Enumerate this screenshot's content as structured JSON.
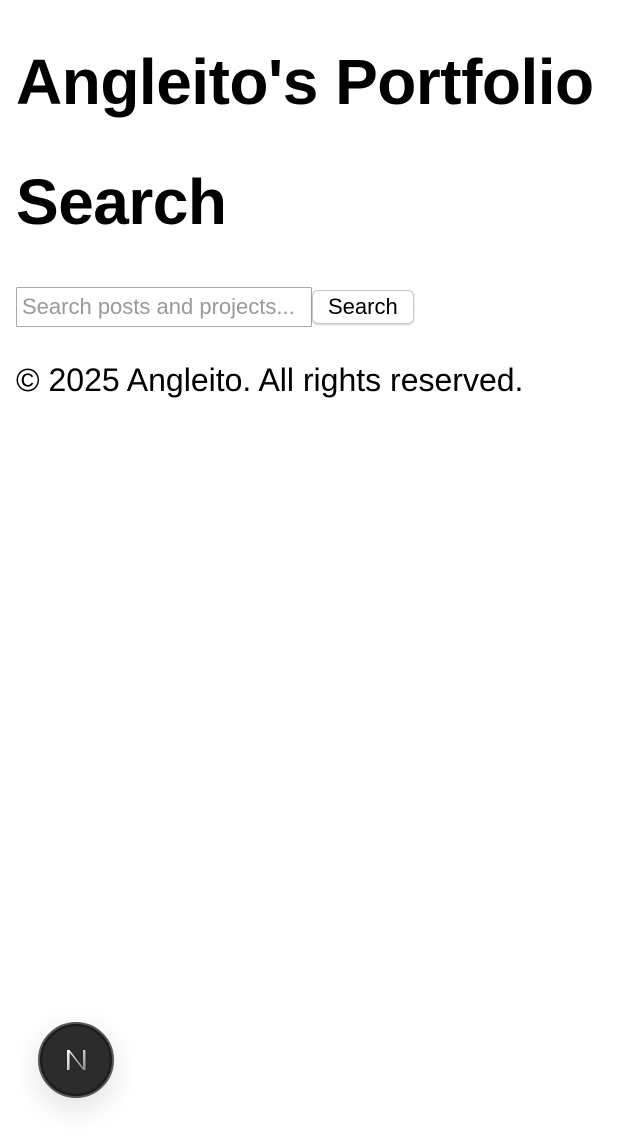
{
  "header": {
    "site_title": "Angleito's Portfolio"
  },
  "main": {
    "page_title": "Search",
    "search": {
      "placeholder": "Search posts and projects...",
      "value": "",
      "button_label": "Search"
    }
  },
  "footer": {
    "copyright": "© 2025 Angleito. All rights reserved."
  },
  "dev_badge": {
    "icon": "nextjs-logo-icon",
    "letter": "N",
    "colors": {
      "background": "#2b2b2b",
      "foreground": "#ffffff"
    }
  }
}
